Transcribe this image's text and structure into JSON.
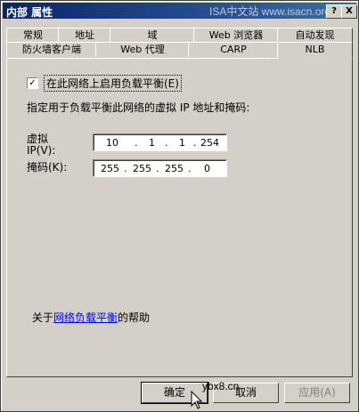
{
  "window": {
    "title": "内部 属性",
    "watermark_top": "ISA中文站 www.isacn.org",
    "help_btn": "?",
    "close_btn": "X"
  },
  "tabs": {
    "row1": [
      "常规",
      "地址",
      "域",
      "Web 浏览器",
      "自动发现"
    ],
    "row2": [
      "防火墙客户端",
      "Web 代理",
      "CARP",
      "NLB"
    ]
  },
  "nlb": {
    "enable_label": "在此网络上启用负载平衡(E)",
    "enable_checked": "✓",
    "description": "指定用于负载平衡此网络的虚拟 IP 地址和掩码:",
    "vip_label_1": "虚拟",
    "vip_label_2": "IP(V):",
    "vip": [
      "10",
      "1",
      "1",
      "254"
    ],
    "mask_label": "掩码(K):",
    "mask": [
      "255",
      "255",
      "255",
      "0"
    ],
    "help_prefix": "关于",
    "help_link": "网络负载平衡",
    "help_suffix": "的帮助"
  },
  "buttons": {
    "ok": "确定",
    "cancel": "取消",
    "apply": "应用(A)"
  },
  "watermark_bottom": "ybx8.cn"
}
